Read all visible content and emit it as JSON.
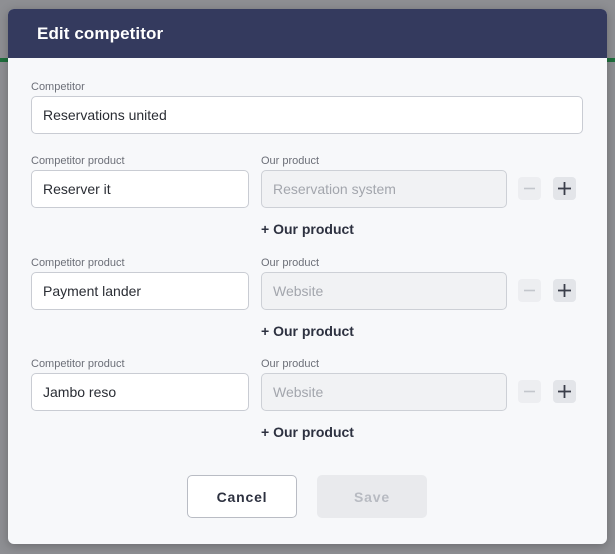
{
  "modal": {
    "title": "Edit competitor"
  },
  "competitor": {
    "label": "Competitor",
    "value": "Reservations united"
  },
  "rows": [
    {
      "competitor_product_label": "Competitor product",
      "competitor_product_value": "Reserver it",
      "our_product_label": "Our product",
      "our_product_placeholder": "Reservation system",
      "add_our_product": "+ Our product"
    },
    {
      "competitor_product_label": "Competitor product",
      "competitor_product_value": "Payment lander",
      "our_product_label": "Our product",
      "our_product_placeholder": "Website",
      "add_our_product": "+ Our product"
    },
    {
      "competitor_product_label": "Competitor product",
      "competitor_product_value": "Jambo reso",
      "our_product_label": "Our product",
      "our_product_placeholder": "Website",
      "add_our_product": "+ Our product"
    }
  ],
  "footer": {
    "cancel_label": "Cancel",
    "save_label": "Save"
  },
  "icons": {
    "remove": "minus-icon",
    "add": "plus-icon"
  },
  "colors": {
    "header_bg": "#343a5e",
    "modal_bg": "#f7f8fa",
    "backdrop": "#8e8f93"
  }
}
